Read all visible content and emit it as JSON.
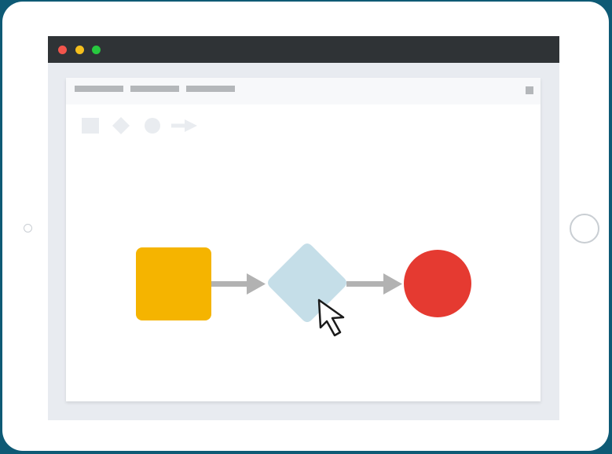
{
  "colors": {
    "background": "#0e5a75",
    "tablet": "#ffffff",
    "titlebar": "#2f3336",
    "window_bg": "#e8ebf0",
    "toolbar_bg": "#f7f8fa",
    "menu_placeholder": "#b4b7ba",
    "palette_icon": "#e9ecf0",
    "traffic_close": "#f2554c",
    "traffic_minimize": "#f5bf1d",
    "traffic_zoom": "#27c93f",
    "process_node": "#f5b400",
    "decision_node": "#c5dee8",
    "end_node": "#e53a31",
    "connector": "#b2b2b2",
    "cursor_fill": "#ffffff",
    "cursor_stroke": "#1a1a1a"
  },
  "window": {
    "traffic_lights": [
      "close",
      "minimize",
      "zoom"
    ]
  },
  "toolbar": {
    "menu_items": [
      "menu-placeholder-1",
      "menu-placeholder-2",
      "menu-placeholder-3"
    ],
    "menu_button_icon": "square-icon"
  },
  "palette": {
    "icons": [
      "square-shape-icon",
      "diamond-shape-icon",
      "circle-shape-icon",
      "arrow-connector-icon"
    ]
  },
  "diagram": {
    "nodes": [
      {
        "id": "process",
        "shape": "rounded-square",
        "color": "#f5b400"
      },
      {
        "id": "decision",
        "shape": "diamond",
        "color": "#c5dee8"
      },
      {
        "id": "end",
        "shape": "circle",
        "color": "#e53a31"
      }
    ],
    "edges": [
      {
        "from": "process",
        "to": "decision"
      },
      {
        "from": "decision",
        "to": "end"
      }
    ],
    "cursor": "mouse-pointer-icon"
  }
}
